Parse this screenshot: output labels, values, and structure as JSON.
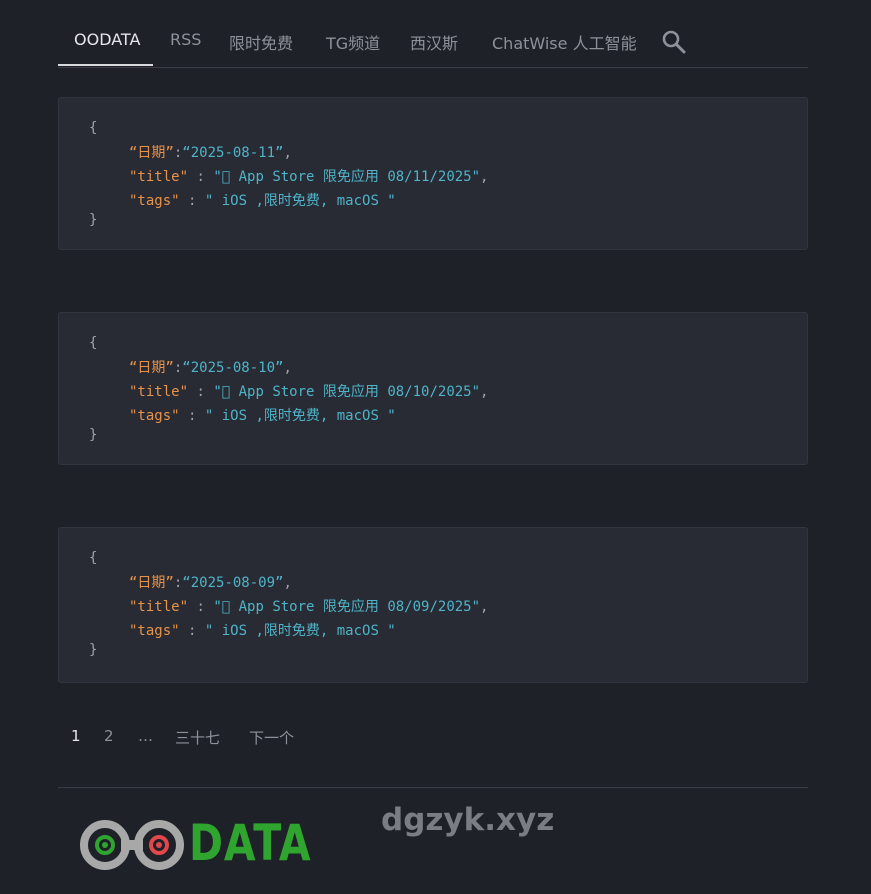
{
  "nav": {
    "items": [
      {
        "label": "OODATA",
        "active": true
      },
      {
        "label": "RSS",
        "active": false
      },
      {
        "label": "限时免费",
        "active": false
      },
      {
        "label": "TG频道",
        "active": false
      },
      {
        "label": "西汉斯",
        "active": false
      },
      {
        "label": "ChatWise 人工智能",
        "active": false
      }
    ]
  },
  "posts": [
    {
      "open": "{",
      "close": "}",
      "date_key": "“日期”",
      "date_sep": ":",
      "date_val": "“2025-08-11”",
      "date_end": ",",
      "title_key": "\"title\"",
      "title_sep": " : ",
      "title_val": "\" App Store 限免应用 08/11/2025\"",
      "title_end": ",",
      "tags_key": "\"tags\"",
      "tags_sep": " : ",
      "tags_val": "\" iOS ,限时免费, macOS \""
    },
    {
      "open": "{",
      "close": "}",
      "date_key": "“日期”",
      "date_sep": ":",
      "date_val": "“2025-08-10”",
      "date_end": ",",
      "title_key": "\"title\"",
      "title_sep": " : ",
      "title_val": "\" App Store 限免应用 08/10/2025\"",
      "title_end": ",",
      "tags_key": "\"tags\"",
      "tags_sep": " : ",
      "tags_val": "\" iOS ,限时免费, macOS \""
    },
    {
      "open": "{",
      "close": "}",
      "date_key": "“日期”",
      "date_sep": ":",
      "date_val": "“2025-08-09”",
      "date_end": ",",
      "title_key": "\"title\"",
      "title_sep": " : ",
      "title_val": "\" App Store 限免应用 08/09/2025\"",
      "title_end": ",",
      "tags_key": "\"tags\"",
      "tags_sep": " : ",
      "tags_val": "\" iOS ,限时免费, macOS \""
    }
  ],
  "pagination": {
    "current": "1",
    "next_page": "2",
    "ellipsis": "…",
    "last": "三十七",
    "next_label": "下一个"
  },
  "footer": {
    "logo_text": "DATA",
    "site": "dgzyk.xyz"
  },
  "colors": {
    "background": "#1f2128",
    "card": "#282b33",
    "json_key": "#e8934a",
    "json_value": "#4fb3c9",
    "logo_green": "#2fa52f",
    "logo_red": "#e2474b"
  }
}
